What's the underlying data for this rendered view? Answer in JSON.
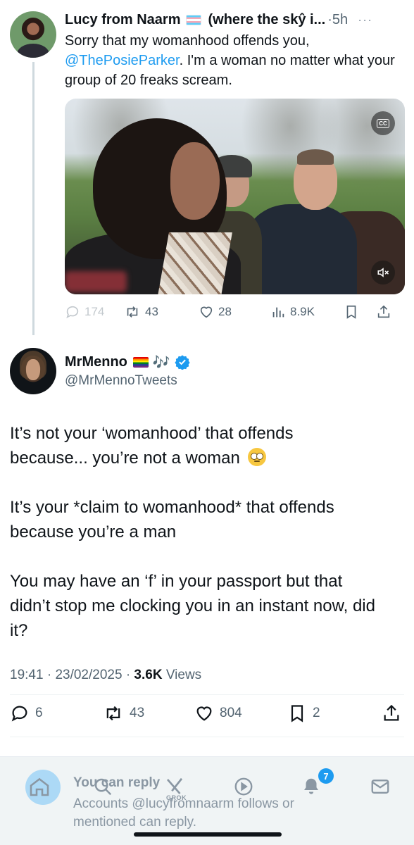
{
  "parent_tweet": {
    "display_name": "Lucy from Naarm",
    "flag_icon": "transgender-flag",
    "display_name_suffix": "(where the skŷ i...",
    "separator": "·",
    "time": "5h",
    "more_label": "···",
    "text_line1": "Sorry that my womanhood offends you,",
    "mention": "@ThePosieParker",
    "text_rest": ". I'm a woman no matter what your group of 20 freaks scream.",
    "media": {
      "cc_label": "CC"
    },
    "stats": {
      "replies": "174",
      "reposts": "43",
      "likes": "28",
      "views": "8.9K"
    }
  },
  "main_tweet": {
    "display_name": "MrMenno",
    "emoji_suffix": "🎶",
    "handle": "@MrMennoTweets",
    "body": {
      "p1a": "It’s not your ‘womanhood’ that offends",
      "p1b": "because... you’re not a woman",
      "p2a": "It’s your *claim to womanhood* that offends",
      "p2b": "because you’re a man",
      "p3a": "You may have an ‘f’ in your passport but that",
      "p3b": "didn’t stop me clocking you in an instant now, did",
      "p3c": "it?"
    },
    "time": "19:41",
    "date": "23/02/2025",
    "sep": "·",
    "views_count": "3.6K",
    "views_label": "Views",
    "stats": {
      "replies": "6",
      "reposts": "43",
      "likes": "804",
      "bookmarks": "2"
    }
  },
  "reply_bar": {
    "title": "You can reply",
    "note": "Accounts @lucyfromnaarm follows or mentioned can reply."
  },
  "nav": {
    "grok_label": "GROK",
    "notifications_badge": "7"
  },
  "colors": {
    "accent": "#1d9bf0",
    "secondary_text": "#536471",
    "primary_text": "#0f1419",
    "verified": "#1d9bf0"
  }
}
